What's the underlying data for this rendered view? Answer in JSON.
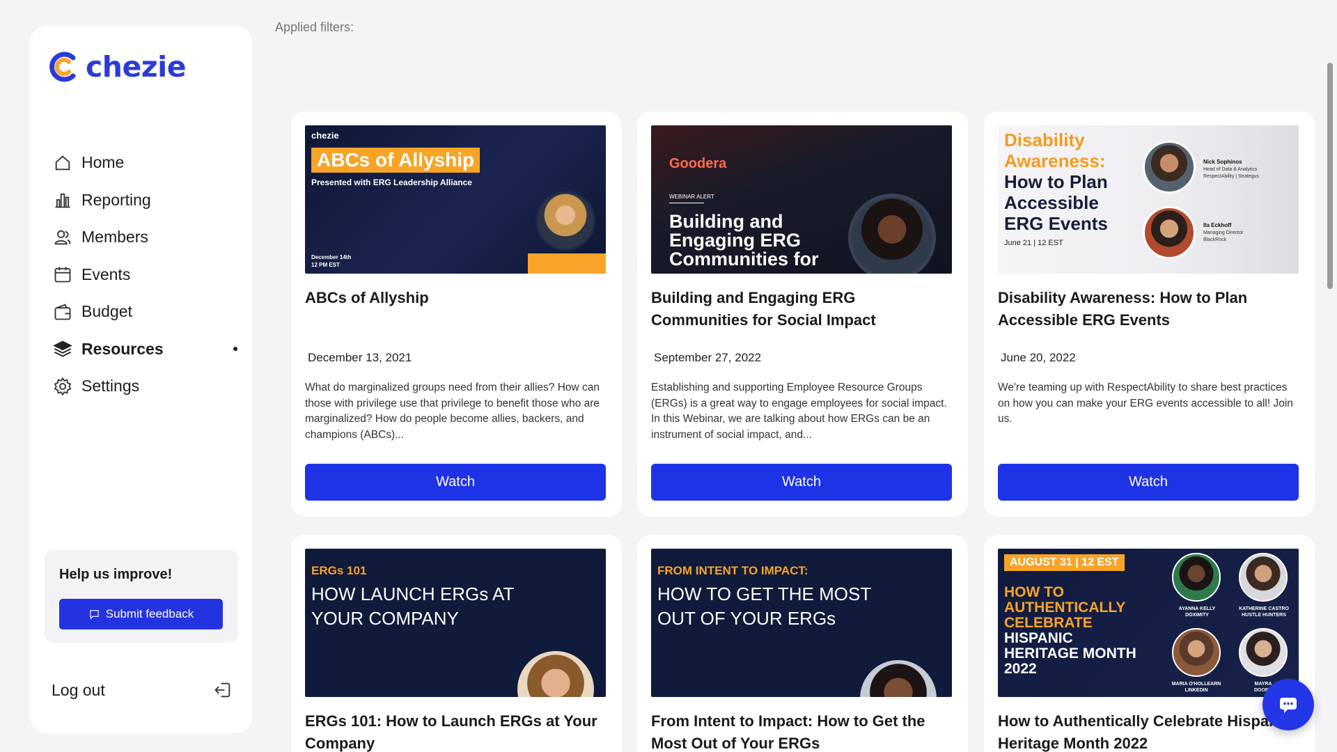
{
  "brand": {
    "name": "chezie",
    "color": "#2b3bd6"
  },
  "sidebar": {
    "items": [
      {
        "label": "Home",
        "icon": "home-icon"
      },
      {
        "label": "Reporting",
        "icon": "bar-chart-icon"
      },
      {
        "label": "Members",
        "icon": "members-icon"
      },
      {
        "label": "Events",
        "icon": "calendar-icon"
      },
      {
        "label": "Budget",
        "icon": "wallet-icon"
      },
      {
        "label": "Resources",
        "icon": "stack-icon",
        "active": true
      },
      {
        "label": "Settings",
        "icon": "gear-icon"
      }
    ],
    "help_title": "Help us improve!",
    "feedback_label": "Submit feedback",
    "logout_label": "Log out"
  },
  "main": {
    "filters_label": "Applied filters:",
    "watch_label": "Watch",
    "cards": [
      {
        "title": "ABCs of Allyship",
        "date": "December 13, 2021",
        "description": "What do marginalized groups need from their allies? How can those with privilege use that privilege to benefit those who are marginalized? How do people become allies, backers, and champions (ABCs)...",
        "thumb": {
          "brand": "chezie",
          "headline": "ABCs of Allyship",
          "sub": "Presented with ERG Leadership Alliance",
          "date": "December 14th",
          "time": "12 PM EST"
        }
      },
      {
        "title": "Building and Engaging ERG Communities for Social Impact",
        "date": "September 27, 2022",
        "description": "Establishing and supporting Employee Resource Groups (ERGs) is a great way to engage employees for social impact. In this Webinar, we are talking about how ERGs can be an instrument of social impact, and...",
        "thumb": {
          "brand": "Goodera",
          "tag": "WEBINAR ALERT",
          "headline": "Building and Engaging ERG Communities for"
        }
      },
      {
        "title": "Disability Awareness: How to Plan Accessible ERG Events",
        "date": "June 20, 2022",
        "description": "We're teaming up with RespectAbility to share best practices on how you can make your ERG events accessible to all! Join us.",
        "thumb": {
          "tag": "Disability Awareness:",
          "headline": "How to Plan Accessible ERG Events",
          "date": "June 21 | 12 EST",
          "speaker1": "Nick Sophinos",
          "speaker1_role": "Head of Data & Analytics RespectAbility | Strategus",
          "speaker2": "Ila Eckhoff",
          "speaker2_role": "Managing Director BlackRock"
        }
      },
      {
        "title": "ERGs 101: How to Launch ERGs at Your Company",
        "thumb": {
          "tag": "ERGs 101",
          "headline": "HOW LAUNCH ERGs AT YOUR COMPANY"
        }
      },
      {
        "title": "From Intent to Impact: How to Get the Most Out of Your ERGs",
        "thumb": {
          "tag": "FROM INTENT TO IMPACT:",
          "headline": "HOW TO GET THE MOST OUT OF YOUR ERGs"
        }
      },
      {
        "title": "How to Authentically Celebrate Hispanic Heritage Month 2022",
        "thumb": {
          "tag": "AUGUST 31 | 12 EST",
          "headline1": "HOW TO AUTHENTICALLY CELEBRATE",
          "headline2": "HISPANIC HERITAGE MONTH 2022",
          "p1": "AYANNA KELLY",
          "p1_org": "DOXIMITY",
          "p2": "KATHERINE CASTRO",
          "p2_org": "HUSTLE HUNTERS",
          "p3": "MARIA O'HOLLEARN",
          "p3_org": "LINKEDIN",
          "p4": "MAYRA",
          "p4_org": "DOORD"
        }
      }
    ]
  },
  "colors": {
    "primary": "#1f33e6",
    "accent": "#f7a428",
    "navy": "#101a3a"
  }
}
